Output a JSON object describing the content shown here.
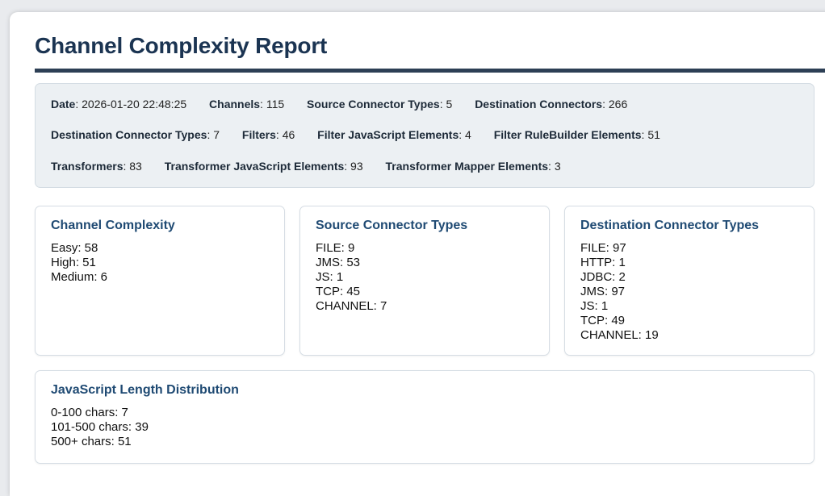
{
  "report": {
    "title": "Channel Complexity Report"
  },
  "summary": {
    "row1": [
      {
        "key": "Date",
        "value": ": 2026-01-20 22:48:25"
      },
      {
        "key": "Channels",
        "value": ": 115"
      },
      {
        "key": "Source Connector Types",
        "value": ": 5"
      },
      {
        "key": "Destination Connectors",
        "value": ": 266"
      }
    ],
    "row2": [
      {
        "key": "Destination Connector Types",
        "value": ": 7"
      },
      {
        "key": "Filters",
        "value": ": 46"
      },
      {
        "key": "Filter JavaScript Elements",
        "value": ": 4"
      },
      {
        "key": "Filter RuleBuilder Elements",
        "value": ": 51"
      }
    ],
    "row3": [
      {
        "key": "Transformers",
        "value": ": 83"
      },
      {
        "key": "Transformer JavaScript Elements",
        "value": ": 93"
      },
      {
        "key": "Transformer Mapper Elements",
        "value": ": 3"
      }
    ]
  },
  "cards": {
    "complexity": {
      "title": "Channel Complexity",
      "items": [
        "Easy: 58",
        "High: 51",
        "Medium: 6"
      ]
    },
    "source": {
      "title": "Source Connector Types",
      "items": [
        "FILE: 9",
        "JMS: 53",
        "JS: 1",
        "TCP: 45",
        "CHANNEL: 7"
      ]
    },
    "destination": {
      "title": "Destination Connector Types",
      "items": [
        "FILE: 97",
        "HTTP: 1",
        "JDBC: 2",
        "JMS: 97",
        "JS: 1",
        "TCP: 49",
        "CHANNEL: 19"
      ]
    },
    "js_length": {
      "title": "JavaScript Length Distribution",
      "items": [
        "0-100 chars: 7",
        "101-500 chars: 39",
        "500+ chars: 51"
      ]
    }
  },
  "colors": {
    "title": "#1b3452",
    "card_heading": "#1f4a73",
    "rule": "#2d3f55",
    "summary_bg": "#ecf0f3"
  }
}
